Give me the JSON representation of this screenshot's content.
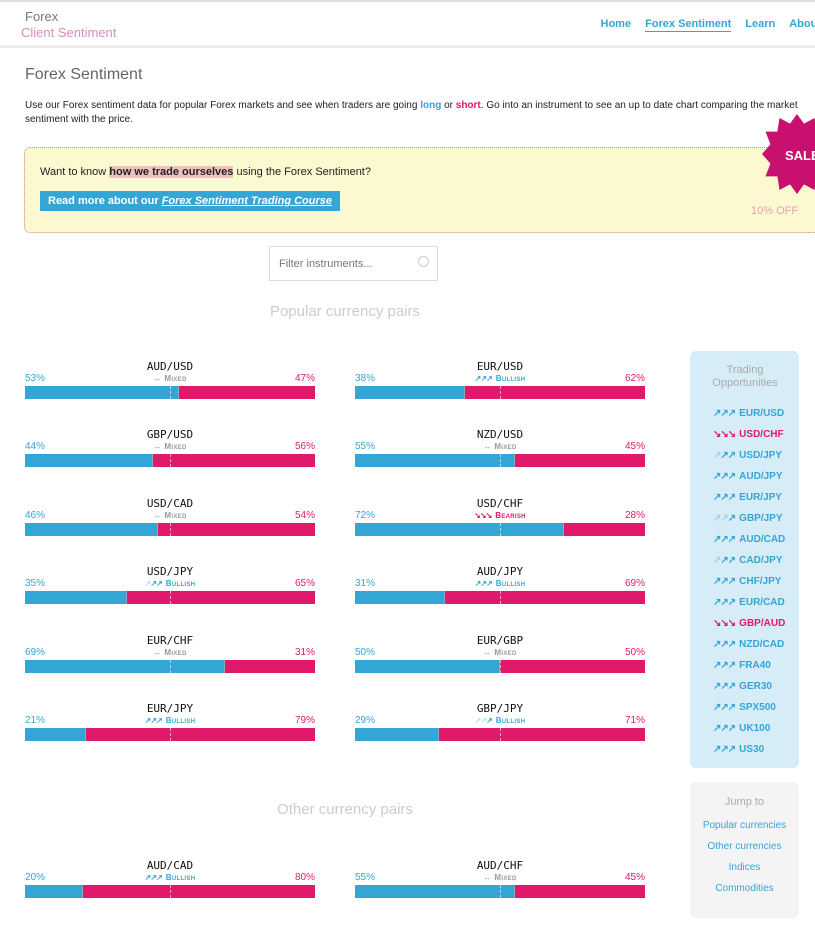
{
  "header": {
    "logo_line1": "Forex",
    "logo_line2": "Client Sentiment",
    "nav": [
      "Home",
      "Forex Sentiment",
      "Learn",
      "About"
    ],
    "active_nav": "Forex Sentiment"
  },
  "page": {
    "title": "Forex Sentiment",
    "intro_before": "Use our Forex sentiment data for popular Forex markets and see when traders are going ",
    "intro_long": "long",
    "intro_or": " or ",
    "intro_short": "short",
    "intro_after": ". Go into an instrument to see an up to date chart comparing the market sentiment with the price."
  },
  "promo": {
    "q_before": "Want to know ",
    "q_bold": "how we trade ourselves",
    "q_after": " using the Forex Sentiment?",
    "btn_before": "Read more about our ",
    "btn_link": "Forex Sentiment Trading Course",
    "sale": "SALE",
    "discount": "10% OFF"
  },
  "filter": {
    "placeholder": "Filter instruments..."
  },
  "sections": {
    "popular": "Popular currency pairs",
    "other": "Other currency pairs"
  },
  "colors": {
    "long": "#34a6d6",
    "short": "#e0196a",
    "mixed": "#999999"
  },
  "popular_pairs": [
    {
      "name": "AUD/USD",
      "long": 53,
      "short": 47,
      "sentiment": "Mixed",
      "strength": 0
    },
    {
      "name": "EUR/USD",
      "long": 38,
      "short": 62,
      "sentiment": "Bullish",
      "strength": 3
    },
    {
      "name": "GBP/USD",
      "long": 44,
      "short": 56,
      "sentiment": "Mixed",
      "strength": 0
    },
    {
      "name": "NZD/USD",
      "long": 55,
      "short": 45,
      "sentiment": "Mixed",
      "strength": 0
    },
    {
      "name": "USD/CAD",
      "long": 46,
      "short": 54,
      "sentiment": "Mixed",
      "strength": 0
    },
    {
      "name": "USD/CHF",
      "long": 72,
      "short": 28,
      "sentiment": "Bearish",
      "strength": 3
    },
    {
      "name": "USD/JPY",
      "long": 35,
      "short": 65,
      "sentiment": "Bullish",
      "strength": 2
    },
    {
      "name": "AUD/JPY",
      "long": 31,
      "short": 69,
      "sentiment": "Bullish",
      "strength": 3
    },
    {
      "name": "EUR/CHF",
      "long": 69,
      "short": 31,
      "sentiment": "Mixed",
      "strength": 0
    },
    {
      "name": "EUR/GBP",
      "long": 50,
      "short": 50,
      "sentiment": "Mixed",
      "strength": 0
    },
    {
      "name": "EUR/JPY",
      "long": 21,
      "short": 79,
      "sentiment": "Bullish",
      "strength": 3
    },
    {
      "name": "GBP/JPY",
      "long": 29,
      "short": 71,
      "sentiment": "Bullish",
      "strength": 1
    }
  ],
  "other_pairs": [
    {
      "name": "AUD/CAD",
      "long": 20,
      "short": 80,
      "sentiment": "Bullish",
      "strength": 3
    },
    {
      "name": "AUD/CHF",
      "long": 55,
      "short": 45,
      "sentiment": "Mixed",
      "strength": 0
    }
  ],
  "opportunities": {
    "title": "Trading Opportunities",
    "items": [
      {
        "name": "EUR/USD",
        "dir": "bull",
        "strength": 3
      },
      {
        "name": "USD/CHF",
        "dir": "bear",
        "strength": 3
      },
      {
        "name": "USD/JPY",
        "dir": "bull",
        "strength": 2
      },
      {
        "name": "AUD/JPY",
        "dir": "bull",
        "strength": 3
      },
      {
        "name": "EUR/JPY",
        "dir": "bull",
        "strength": 3
      },
      {
        "name": "GBP/JPY",
        "dir": "bull",
        "strength": 1
      },
      {
        "name": "AUD/CAD",
        "dir": "bull",
        "strength": 3
      },
      {
        "name": "CAD/JPY",
        "dir": "bull",
        "strength": 2
      },
      {
        "name": "CHF/JPY",
        "dir": "bull",
        "strength": 3
      },
      {
        "name": "EUR/CAD",
        "dir": "bull",
        "strength": 3
      },
      {
        "name": "GBP/AUD",
        "dir": "bear",
        "strength": 3
      },
      {
        "name": "NZD/CAD",
        "dir": "bull",
        "strength": 3
      },
      {
        "name": "FRA40",
        "dir": "bull",
        "strength": 3
      },
      {
        "name": "GER30",
        "dir": "bull",
        "strength": 3
      },
      {
        "name": "SPX500",
        "dir": "bull",
        "strength": 3
      },
      {
        "name": "UK100",
        "dir": "bull",
        "strength": 3
      },
      {
        "name": "US30",
        "dir": "bull",
        "strength": 3
      }
    ]
  },
  "jump": {
    "title": "Jump to",
    "links": [
      "Popular currencies",
      "Other currencies",
      "Indices",
      "Commodities"
    ]
  }
}
